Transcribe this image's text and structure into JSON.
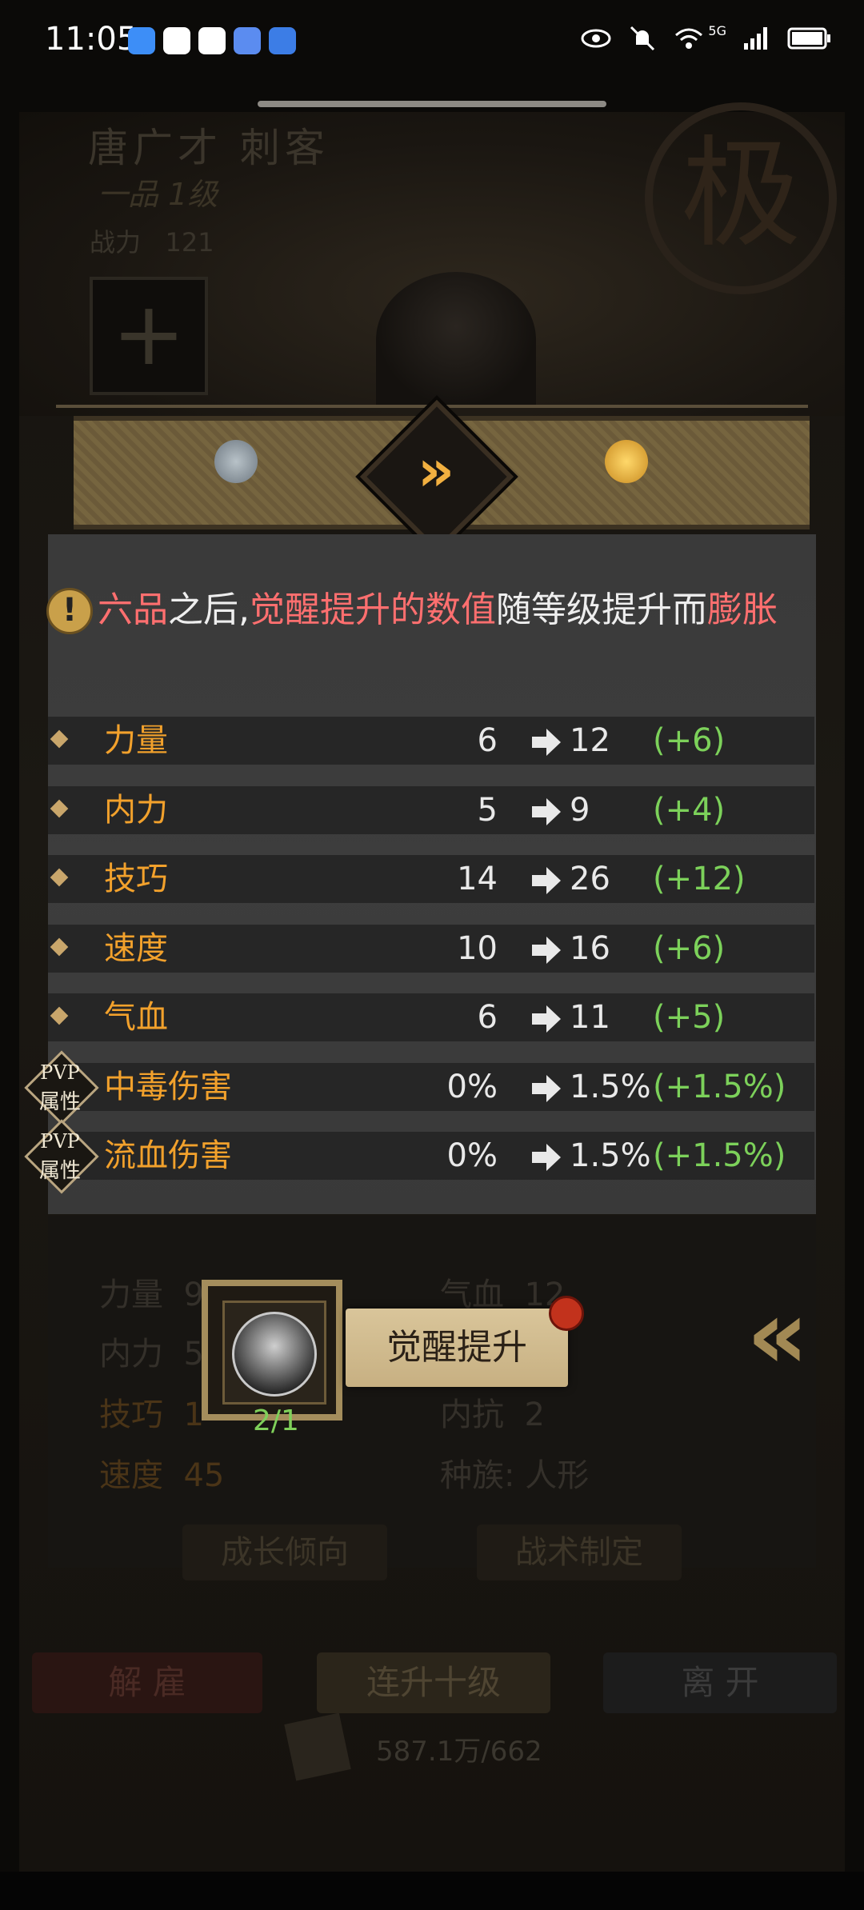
{
  "status_bar": {
    "time": "11:05",
    "network": "5G",
    "icons": [
      "shield-icon",
      "app-icon",
      "app-icon",
      "music-icon",
      "browser-icon",
      "eye-icon",
      "bell-off-icon",
      "wifi-icon",
      "signal-icon",
      "battery-icon"
    ]
  },
  "background": {
    "character_name": "唐广才   刺客",
    "rank": "一品   1级",
    "power_label": "战力",
    "power_value": "121",
    "seal_char": "极",
    "stats_left": [
      {
        "label": "力量",
        "value": "9"
      },
      {
        "label": "内力",
        "value": "5"
      },
      {
        "label": "技巧",
        "value": "1"
      },
      {
        "label": "速度",
        "value": "45"
      }
    ],
    "stats_right": [
      {
        "label": "气血",
        "value": "12"
      },
      {
        "label": "内抗",
        "value": "2"
      },
      {
        "label": "种族:",
        "value": "人形"
      }
    ],
    "buttons": {
      "growth": "成长倾向",
      "tactics": "战术制定",
      "dismiss": "解  雇",
      "level_ten": "连升十级",
      "leave": "离  开"
    },
    "resource": "587.1万/662"
  },
  "notice": {
    "part1": "六品",
    "part2": "之后,",
    "part3": "觉醒提升的数值",
    "part4": "随等级提升而",
    "part5": "膨胀"
  },
  "stats": [
    {
      "name": "力量",
      "old": "6",
      "new": "12",
      "delta": "(+6)",
      "pvp": false
    },
    {
      "name": "内力",
      "old": "5",
      "new": "9",
      "delta": "(+4)",
      "pvp": false
    },
    {
      "name": "技巧",
      "old": "14",
      "new": "26",
      "delta": "(+12)",
      "pvp": false
    },
    {
      "name": "速度",
      "old": "10",
      "new": "16",
      "delta": "(+6)",
      "pvp": false
    },
    {
      "name": "气血",
      "old": "6",
      "new": "11",
      "delta": "(+5)",
      "pvp": false
    },
    {
      "name": "中毒伤害",
      "old": "0%",
      "new": "1.5%",
      "delta": "(+1.5%)",
      "pvp": true
    },
    {
      "name": "流血伤害",
      "old": "0%",
      "new": "1.5%",
      "delta": "(+1.5%)",
      "pvp": true
    }
  ],
  "pvp_badge": {
    "line1": "PVP",
    "line2": "属性"
  },
  "awaken": {
    "button_label": "觉醒提升",
    "count": "2/1"
  },
  "colors": {
    "stat_name": "#f2a12c",
    "delta": "#7cd15a",
    "highlight_red": "#ff6f6f",
    "band_gold": "#76653f"
  }
}
